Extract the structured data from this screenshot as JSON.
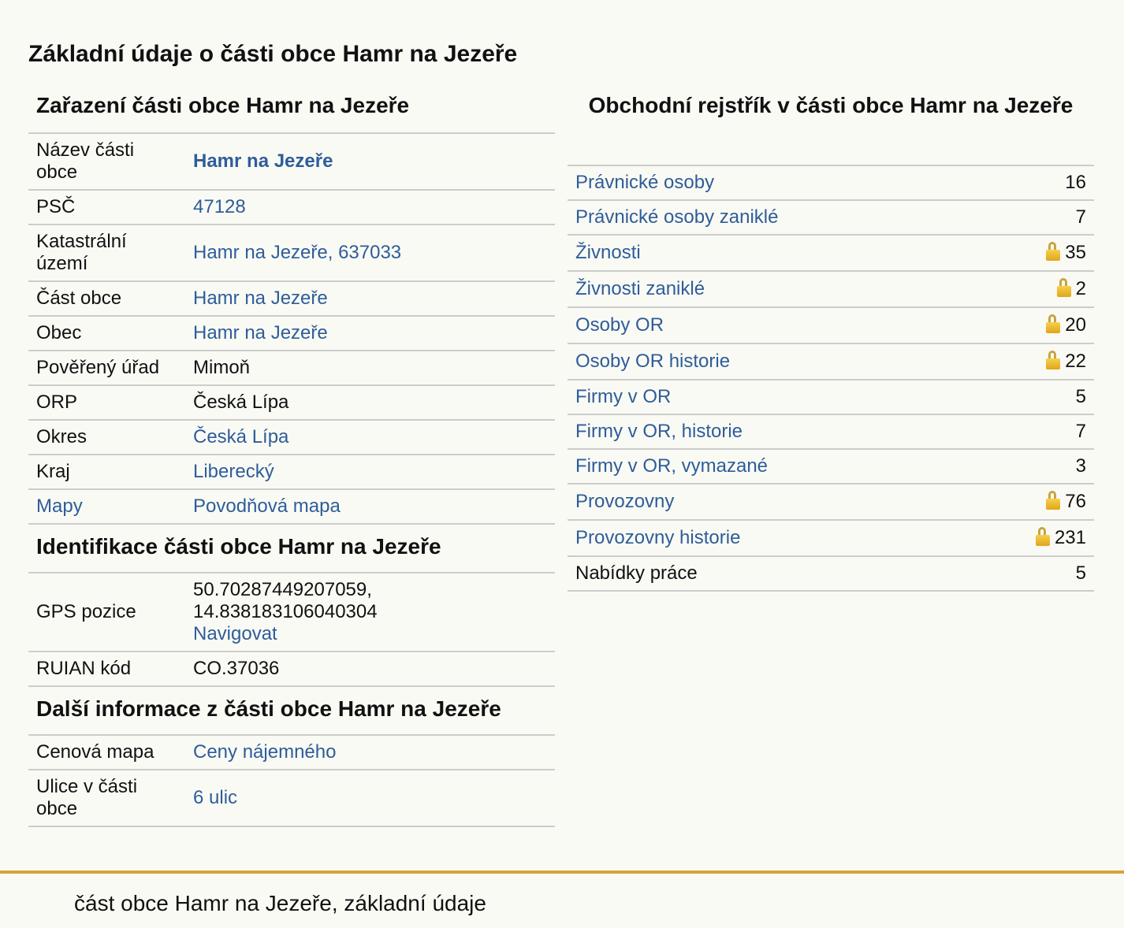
{
  "page": {
    "title": "Základní údaje o části obce Hamr na Jezeře",
    "footer_text": "část obce Hamr na Jezeře, základní údaje"
  },
  "zarazeni": {
    "title": "Zařazení části obce Hamr na Jezeře",
    "rows": [
      {
        "label": "Název části obce",
        "value": "Hamr na Jezeře"
      },
      {
        "label": "PSČ",
        "value": "47128"
      },
      {
        "label": "Katastrální území",
        "value": "Hamr na Jezeře, 637033"
      },
      {
        "label": "Část obce",
        "value": "Hamr na Jezeře"
      },
      {
        "label": "Obec",
        "value": "Hamr na Jezeře"
      },
      {
        "label": "Pověřený úřad",
        "value": "Mimoň"
      },
      {
        "label": "ORP",
        "value": "Česká Lípa"
      },
      {
        "label": "Okres",
        "value": "Česká Lípa"
      },
      {
        "label": "Kraj",
        "value": "Liberecký"
      },
      {
        "label": "Mapy",
        "value": "Povodňová mapa"
      }
    ]
  },
  "identifikace": {
    "title": "Identifikace části obce Hamr na Jezeře",
    "gps_label": "GPS pozice",
    "gps_lat": "50.70287449207059,",
    "gps_lon": "14.838183106040304",
    "navigate_label": "Navigovat",
    "ruian_label": "RUIAN kód",
    "ruian_value": "CO.37036"
  },
  "dalsi": {
    "title": "Další informace z části obce Hamr na Jezeře",
    "rows": [
      {
        "label": "Cenová mapa",
        "value": "Ceny nájemného"
      },
      {
        "label": "Ulice v části obce",
        "value": "6 ulic"
      }
    ]
  },
  "rejstrik": {
    "title": "Obchodní rejstřík v části obce Hamr na Jezeře",
    "rows": [
      {
        "label": "Právnické osoby",
        "count": "16"
      },
      {
        "label": "Právnické osoby zaniklé",
        "count": "7"
      },
      {
        "label": "Živnosti",
        "count": "35"
      },
      {
        "label": "Živnosti zaniklé",
        "count": "2"
      },
      {
        "label": "Osoby OR",
        "count": "20"
      },
      {
        "label": "Osoby OR historie",
        "count": "22"
      },
      {
        "label": "Firmy v OR",
        "count": "5"
      },
      {
        "label": "Firmy v OR, historie",
        "count": "7"
      },
      {
        "label": "Firmy v OR, vymazané",
        "count": "3"
      },
      {
        "label": "Provozovny",
        "count": "76"
      },
      {
        "label": "Provozovny historie",
        "count": "231"
      },
      {
        "label": "Nabídky práce",
        "count": "5"
      }
    ]
  },
  "colors": {
    "link": "#2e5d99",
    "border": "#cccccc",
    "footer_accent": "#d8a43a",
    "background": "#fafaf5"
  },
  "icons": {
    "locked": "lock-icon"
  }
}
